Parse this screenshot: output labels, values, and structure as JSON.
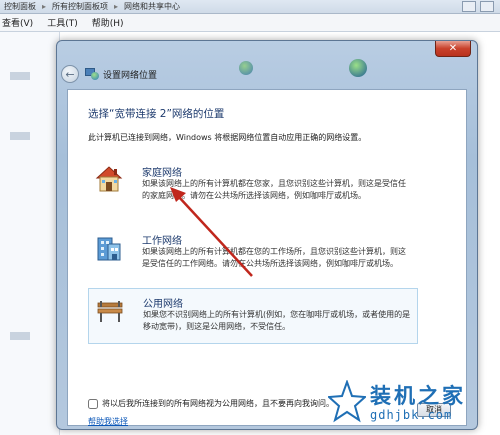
{
  "background": {
    "address_segments": [
      "控制面板",
      "所有控制面板项",
      "网络和共享中心"
    ],
    "menu": [
      "查看(V)",
      "工具(T)",
      "帮助(H)"
    ]
  },
  "dialog": {
    "close_label": "✕",
    "nav_title": "设置网络位置",
    "heading": "选择“宽带连接 2”网络的位置",
    "description": "此计算机已连接到网络，Windows 将根据网络位置自动应用正确的网络设置。",
    "options": [
      {
        "icon": "house-icon",
        "title": "家庭网络",
        "body": "如果该网络上的所有计算机都在您家，且您识别这些计算机，则这是受信任的家庭网络。请勿在公共场所选择该网络，例如咖啡厅或机场。"
      },
      {
        "icon": "office-building-icon",
        "title": "工作网络",
        "body": "如果该网络上的所有计算机都在您的工作场所，且您识别这些计算机，则这是受信任的工作网络。请勿在公共场所选择该网络，例如咖啡厅或机场。"
      },
      {
        "icon": "park-bench-icon",
        "title": "公用网络",
        "body": "如果您不识别网络上的所有计算机(例如，您在咖啡厅或机场，或者使用的是移动宽带)，则这是公用网络，不受信任。"
      }
    ],
    "checkbox_label": "将以后我所连接到的所有网络视为公用网络，且不要再向我询问。",
    "help_link": "帮助我选择",
    "cancel_label": "取消"
  },
  "watermark": {
    "brand": "装机之家",
    "url": "gdhjbk.com"
  },
  "colors": {
    "heading": "#1e3b6e",
    "link": "#0b57b8",
    "annotation_arrow": "#c0271d",
    "watermark": "#1f6fb5"
  }
}
